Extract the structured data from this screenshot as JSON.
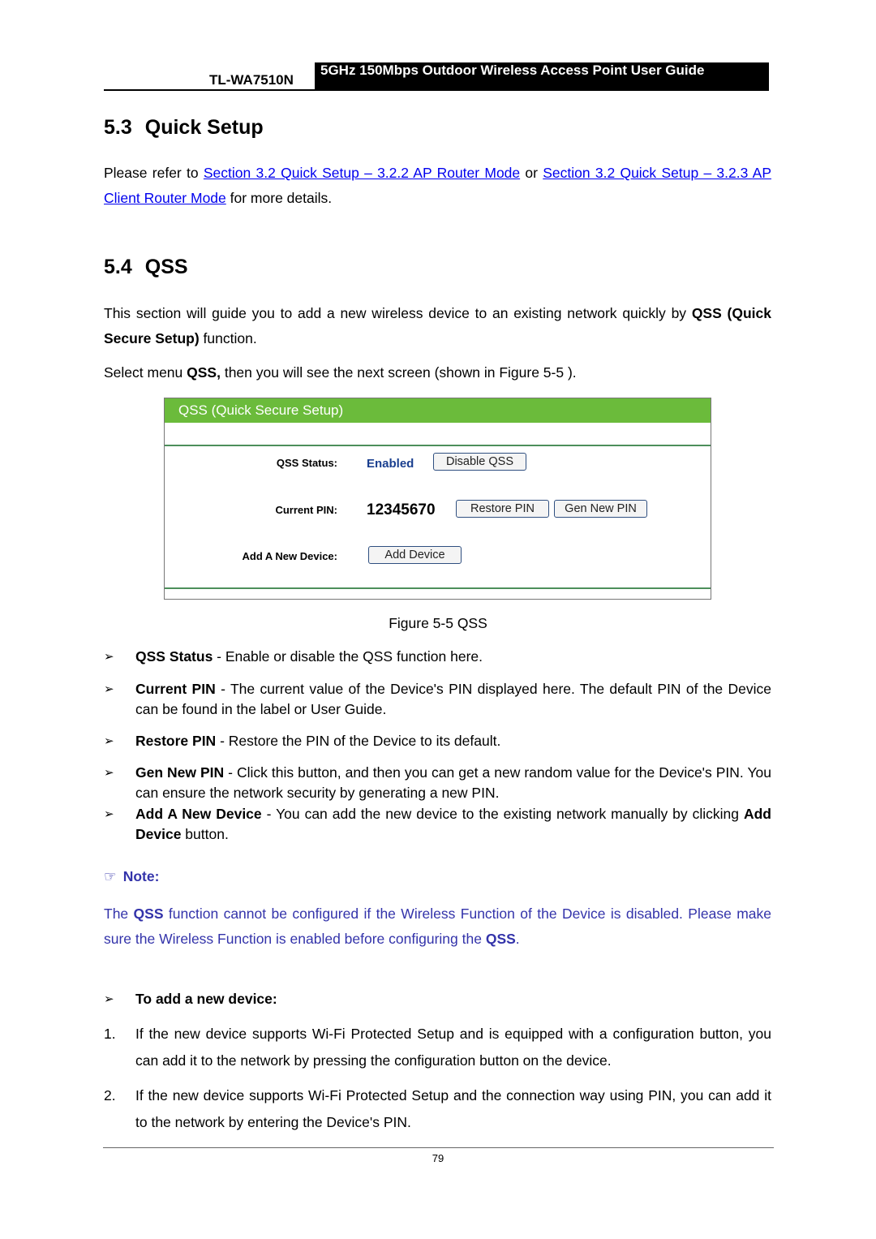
{
  "header": {
    "model": "TL-WA7510N",
    "title": "5GHz 150Mbps Outdoor Wireless Access Point User Guide"
  },
  "section_53": {
    "number": "5.3",
    "title": "Quick Setup",
    "text_before": "Please refer to ",
    "link1": "Section 3.2 Quick Setup – 3.2.2 AP Router Mode",
    "text_between": " or ",
    "link2": "Section 3.2 Quick Setup – 3.2.3 AP Client Router Mode",
    "text_after": " for more details."
  },
  "section_54": {
    "number": "5.4",
    "title": "QSS",
    "intro_before": "This section will guide you to add a new wireless device to an existing network quickly by ",
    "intro_bold": "QSS (Quick Secure Setup)",
    "intro_after": " function.",
    "select_before": "Select menu ",
    "select_bold": "QSS,",
    "select_after": " then you will see the next screen (shown in Figure 5-5 )."
  },
  "figure": {
    "panel_title": "QSS (Quick Secure Setup)",
    "status_label": "QSS Status:",
    "status_value": "Enabled",
    "disable_button": "Disable QSS",
    "pin_label": "Current PIN:",
    "pin_value": "12345670",
    "restore_button": "Restore PIN",
    "gen_button": "Gen New PIN",
    "add_label": "Add A New Device:",
    "add_button": "Add Device",
    "caption": "Figure 5-5 QSS",
    "header_color": "#6bbb3b"
  },
  "bullets": [
    {
      "term": "QSS Status",
      "desc": " - Enable or disable the QSS function here."
    },
    {
      "term": "Current PIN",
      "desc": " - The current value of the Device's PIN displayed here. The default PIN of the Device can be found in the label or User Guide."
    },
    {
      "term": "Restore PIN",
      "desc": " - Restore the PIN of the Device to its default."
    },
    {
      "term": "Gen New PIN",
      "desc": " - Click this button, and then you can get a new random value for the Device's PIN. You can ensure the network security by generating a new PIN."
    },
    {
      "term": "Add A New Device",
      "desc": " - You can add the new device to the existing network manually by clicking ",
      "term2": "Add Device",
      "desc2": " button."
    }
  ],
  "note": {
    "icon": "pointing-hand-icon",
    "label": "Note:",
    "p1": "The ",
    "b1": "QSS",
    "p2": " function cannot be configured if the Wireless Function of the Device is disabled. Please make sure the Wireless Function is enabled before configuring the ",
    "b2": "QSS",
    "p3": ".",
    "color": "#3333aa"
  },
  "add_device": {
    "heading": "To add a new device:",
    "steps": [
      {
        "n": "1.",
        "text": "If the new device supports Wi-Fi Protected Setup and is equipped with a configuration button, you can add it to the network by pressing the configuration button on the device."
      },
      {
        "n": "2.",
        "text": "If the new device supports Wi-Fi Protected Setup and the connection way using PIN, you can add it to the network by entering the Device's PIN."
      }
    ]
  },
  "page_number": "79"
}
